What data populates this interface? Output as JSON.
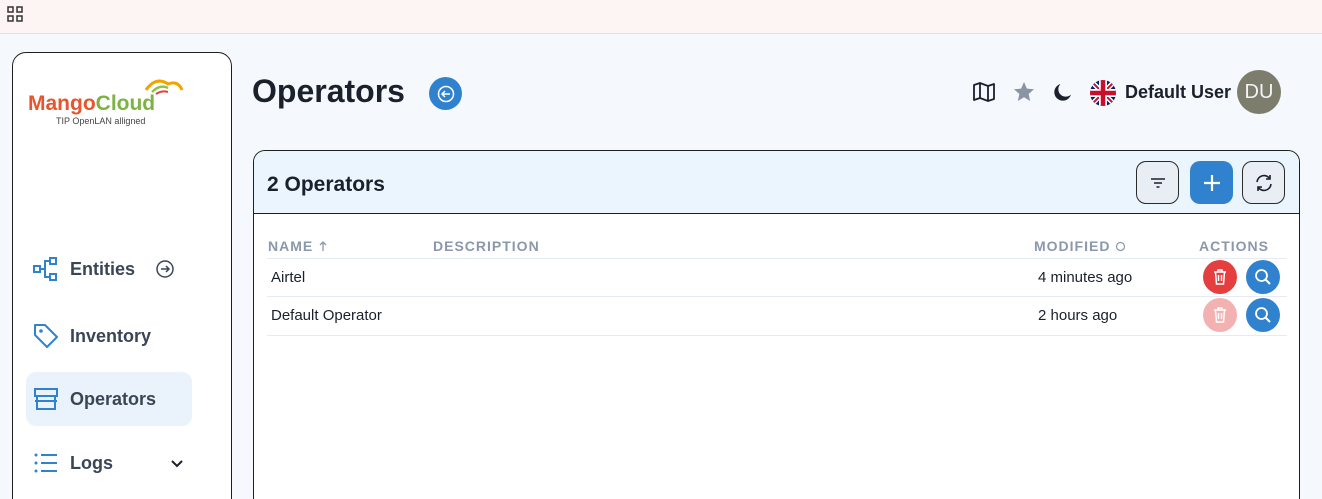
{
  "header": {
    "title": "Operators",
    "user_name": "Default User",
    "user_initials": "DU"
  },
  "sidebar": {
    "logo_name": "MangoCloud",
    "logo_tagline": "TIP OpenLAN alligned",
    "items": [
      {
        "label": "Entities",
        "icon": "entities-icon"
      },
      {
        "label": "Inventory",
        "icon": "tag-icon"
      },
      {
        "label": "Operators",
        "icon": "store-icon",
        "active": true
      },
      {
        "label": "Logs",
        "icon": "list-icon"
      }
    ]
  },
  "card": {
    "title": "2 Operators",
    "columns": [
      "NAME",
      "DESCRIPTION",
      "MODIFIED",
      "ACTIONS"
    ],
    "rows": [
      {
        "name": "Airtel",
        "description": "",
        "modified": "4 minutes ago",
        "delete_enabled": true
      },
      {
        "name": "Default Operator",
        "description": "",
        "modified": "2 hours ago",
        "delete_enabled": false
      }
    ]
  },
  "colors": {
    "primary": "#3182ce",
    "danger": "#e53e3e",
    "danger_disabled": "#f4b1b1",
    "active_nav": "#eaf3fb"
  }
}
